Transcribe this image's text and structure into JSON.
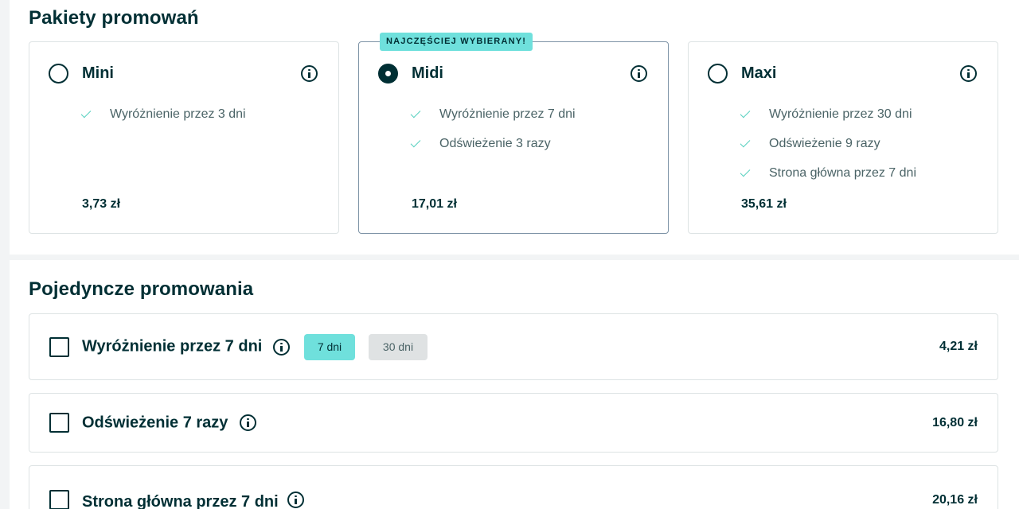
{
  "packages": {
    "title": "Pakiety promowań",
    "items": [
      {
        "name": "Mini",
        "features": [
          "Wyróżnienie przez 3 dni"
        ],
        "price": "3,73 zł",
        "selected": false
      },
      {
        "name": "Midi",
        "badge": "NAJCZĘŚCIEJ WYBIERANY!",
        "features": [
          "Wyróżnienie przez 7 dni",
          "Odświeżenie 3 razy"
        ],
        "price": "17,01 zł",
        "selected": true
      },
      {
        "name": "Maxi",
        "features": [
          "Wyróżnienie przez 30 dni",
          "Odświeżenie 9 razy",
          "Strona główna przez 7 dni"
        ],
        "price": "35,61 zł",
        "selected": false
      }
    ]
  },
  "single": {
    "title": "Pojedyncze promowania",
    "items": [
      {
        "title": "Wyróżnienie przez 7 dni",
        "options": [
          {
            "label": "7 dni",
            "active": true
          },
          {
            "label": "30 dni",
            "active": false
          }
        ],
        "price": "4,21 zł",
        "checked": false
      },
      {
        "title": "Odświeżenie 7 razy",
        "price": "16,80 zł",
        "checked": false
      },
      {
        "title": "Strona główna przez 7 dni",
        "price": "20,16 zł",
        "checked": false
      }
    ]
  },
  "colors": {
    "text": "#002f34",
    "accent": "#6fe0dc",
    "check": "#5ad1c0",
    "border": "#dde3e4",
    "selected_border": "#7d93a6"
  }
}
